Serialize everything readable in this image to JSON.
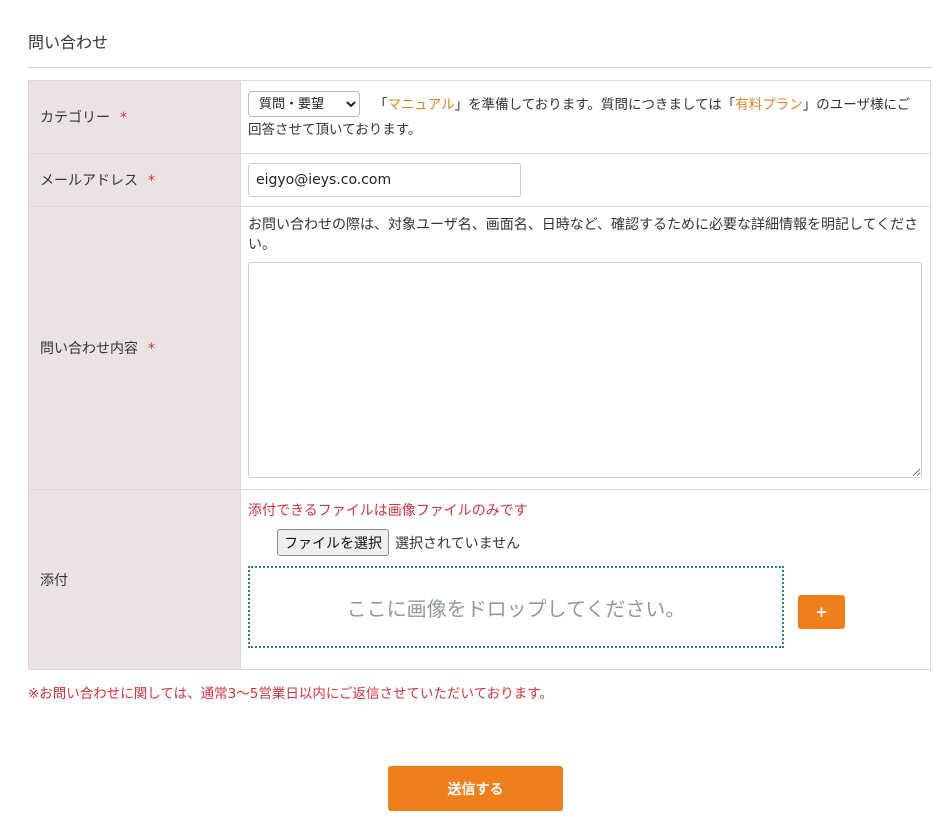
{
  "page": {
    "title": "問い合わせ"
  },
  "form": {
    "required_mark": "*",
    "category": {
      "label": "カテゴリー",
      "selected": "質問・要望",
      "note_open": "「",
      "manual_link": "マニュアル",
      "note_mid": "」を準備しております。質問につきましては「",
      "plan_link": "有料プラン",
      "note_end": "」のユーザ様にご回答させて頂いております。"
    },
    "email": {
      "label": "メールアドレス",
      "value": "eigyo@ieys.co.com"
    },
    "content": {
      "label": "問い合わせ内容",
      "note": "お問い合わせの際は、対象ユーザ名、画面名、日時など、確認するために必要な詳細情報を明記してください。",
      "value": ""
    },
    "attachment": {
      "label": "添付",
      "note": "添付できるファイルは画像ファイルのみです",
      "file_button": "ファイルを選択",
      "file_status": "選択されていません",
      "drop_text": "ここに画像をドロップしてください。",
      "add_button": "+"
    }
  },
  "footnote": "※お問い合わせに関しては、通常3〜5営業日以内にご返信させていただいております。",
  "submit_label": "送信する",
  "colors": {
    "accent": "#ef7f1a",
    "required": "#d3343f",
    "link": "#e2832a",
    "label_bg": "#ebe3e3",
    "dropzone_border": "#2a7f86"
  }
}
